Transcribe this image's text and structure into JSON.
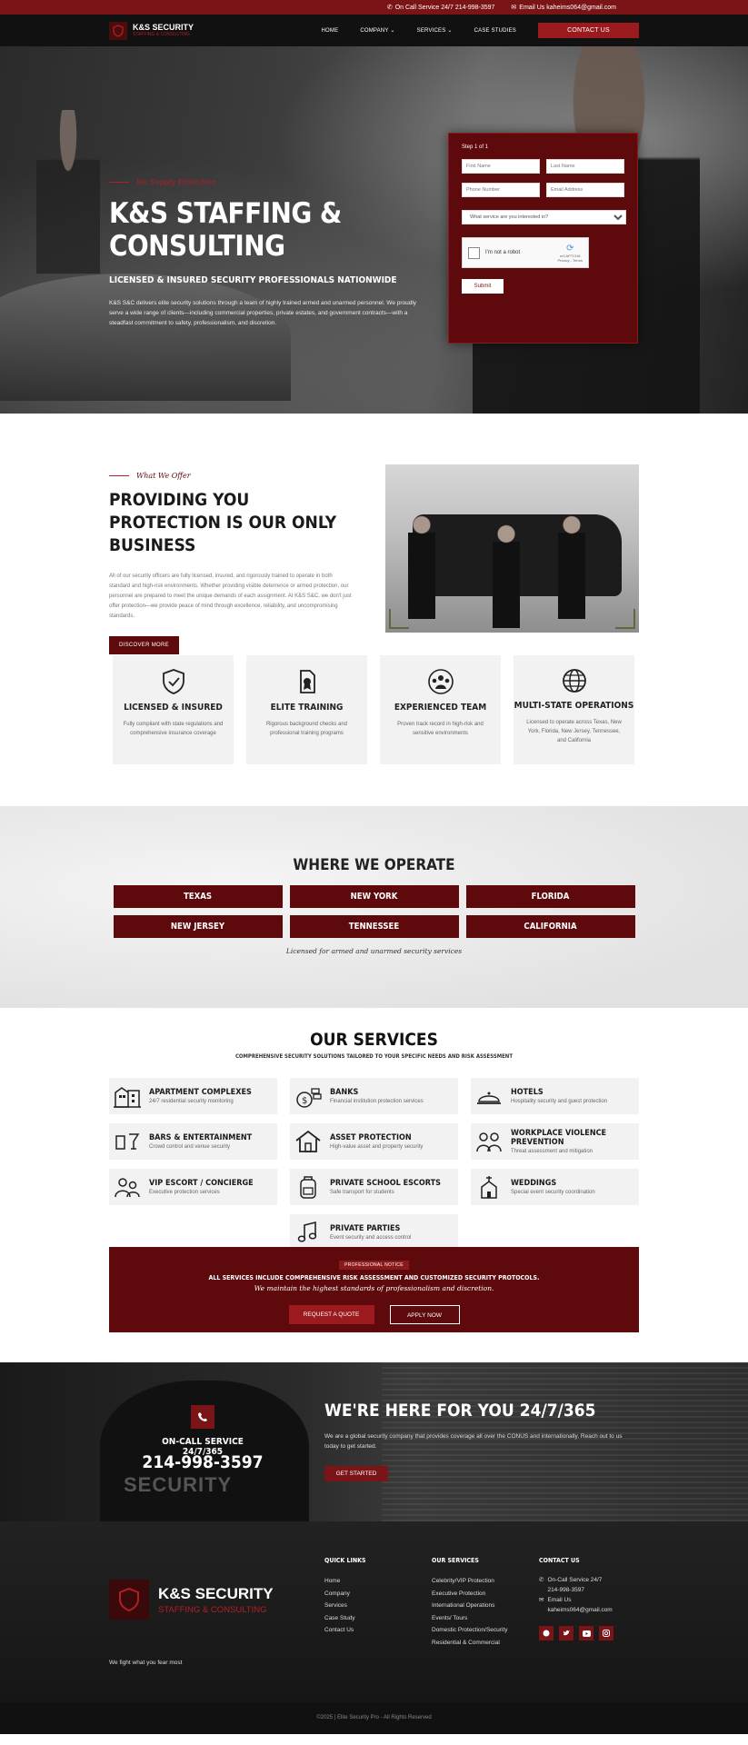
{
  "topbar": {
    "service": "On Call Service 24/7 214-998-3597",
    "email": "Email Us kaheims064@gmail.com"
  },
  "nav": {
    "brand": "K&S SECURITY",
    "brand_sub": "STAFFING & CONSULTING",
    "items": [
      "HOME",
      "COMPANY",
      "SERVICES",
      "CASE STUDIES"
    ],
    "cta": "CONTACT US"
  },
  "hero": {
    "eyebrow": "We Supply Protection",
    "title": "K&S STAFFING & CONSULTING",
    "subtitle": "LICENSED & INSURED SECURITY PROFESSIONALS NATIONWIDE",
    "desc": "K&S S&C delivers elite security solutions through a team of highly trained armed and unarmed personnel. We proudly serve a wide range of clients—including commercial properties, private estates, and government contracts—with a steadfast commitment to safety, professionalism, and discretion."
  },
  "form": {
    "step": "Step 1 of 1",
    "first_name": "First Name",
    "last_name": "Last Name",
    "phone": "Phone Number",
    "email": "Email Address",
    "service": "What service are you interested in?",
    "captcha": "I'm not a robot",
    "captcha_brand": "reCAPTCHA",
    "captcha_terms": "Privacy - Terms",
    "submit": "Submit"
  },
  "offer": {
    "eyebrow": "What We Offer",
    "title": "PROVIDING YOU PROTECTION IS OUR ONLY BUSINESS",
    "desc": "All of our security officers are fully licensed, insured, and rigorously trained to operate in both standard and high-risk environments. Whether providing visible deterrence or armed protection, our personnel are prepared to meet the unique demands of each assignment. At K&S S&C, we don't just offer protection—we provide peace of mind through excellence, reliability, and uncompromising standards.",
    "button": "DISCOVER MORE"
  },
  "features": [
    {
      "icon": "shield-check-icon",
      "title": "LICENSED & INSURED",
      "text": "Fully compliant with state regulations and comprehensive insurance coverage"
    },
    {
      "icon": "certificate-icon",
      "title": "ELITE TRAINING",
      "text": "Rigorous background checks and professional training programs"
    },
    {
      "icon": "team-icon",
      "title": "EXPERIENCED TEAM",
      "text": "Proven track record in high-risk and sensitive environments"
    },
    {
      "icon": "globe-icon",
      "title": "MULTI-STATE OPERATIONS",
      "text": "Licensed to operate across Texas, New York, Florida, New Jersey, Tennessee, and California"
    }
  ],
  "operate": {
    "title": "WHERE WE OPERATE",
    "states": [
      "TEXAS",
      "NEW YORK",
      "FLORIDA",
      "NEW JERSEY",
      "TENNESSEE",
      "CALIFORNIA"
    ],
    "note": "Licensed for armed and unarmed security services"
  },
  "services": {
    "title": "OUR SERVICES",
    "subtitle": "COMPREHENSIVE SECURITY SOLUTIONS TAILORED TO YOUR SPECIFIC NEEDS AND RISK ASSESSMENT",
    "items": [
      {
        "icon": "buildings-icon",
        "title": "APARTMENT COMPLEXES",
        "text": "24/7 residential security monitoring"
      },
      {
        "icon": "bank-icon",
        "title": "BANKS",
        "text": "Financial institution protection services"
      },
      {
        "icon": "bell-icon",
        "title": "HOTELS",
        "text": "Hospitality security and guest protection"
      },
      {
        "icon": "drinks-icon",
        "title": "BARS & ENTERTAINMENT",
        "text": "Crowd control and venue security"
      },
      {
        "icon": "house-icon",
        "title": "ASSET PROTECTION",
        "text": "High-value asset and property security"
      },
      {
        "icon": "workers-icon",
        "title": "WORKPLACE VIOLENCE PREVENTION",
        "text": "Threat assessment and mitigation"
      },
      {
        "icon": "vip-icon",
        "title": "VIP ESCORT / CONCIERGE",
        "text": "Executive protection services"
      },
      {
        "icon": "backpack-icon",
        "title": "PRIVATE SCHOOL ESCORTS",
        "text": "Safe transport for students"
      },
      {
        "icon": "chapel-icon",
        "title": "WEDDINGS",
        "text": "Special event security coordination"
      },
      {
        "icon": "music-icon",
        "title": "PRIVATE PARTIES",
        "text": "Event security and access control"
      }
    ]
  },
  "notice": {
    "badge": "PROFESSIONAL NOTICE",
    "line1": "ALL SERVICES INCLUDE COMPREHENSIVE RISK ASSESSMENT AND CUSTOMIZED SECURITY PROTOCOLS.",
    "line2": "We maintain the highest standards of professionalism and discretion.",
    "quote": "REQUEST A QUOTE",
    "apply": "APPLY NOW"
  },
  "support": {
    "oncall": "ON-CALL SERVICE 24/7/365",
    "number": "214-998-3597",
    "watermark": "SECURITY",
    "title": "WE'RE HERE FOR YOU 24/7/365",
    "desc": "We are a global security company that provides coverage all over the CONUS and internationally. Reach out to us today to get started.",
    "button": "GET STARTED"
  },
  "footer": {
    "brand": "K&S SECURITY",
    "brand_sub": "STAFFING & CONSULTING",
    "tagline": "We fight what you fear most",
    "quick_title": "QUICK LINKS",
    "quick": [
      "Home",
      "Company",
      "Services",
      "Case Study",
      "Contact Us"
    ],
    "services_title": "OUR SERVICES",
    "services": [
      "Celebrity/VIP Protection",
      "Executive Protection",
      "International Operations",
      "Events/ Tours",
      "Domestic Protection/Security",
      "Residential & Commercial"
    ],
    "contact_title": "CONTACT US",
    "contact_service": "On-Call Service 24/7",
    "contact_phone": "214-998-3597",
    "contact_email_label": "Email Us",
    "contact_email": "kaheims064@gmail.com",
    "copyright": "©2025 | Elite Security Pro - All Rights Reserved"
  }
}
